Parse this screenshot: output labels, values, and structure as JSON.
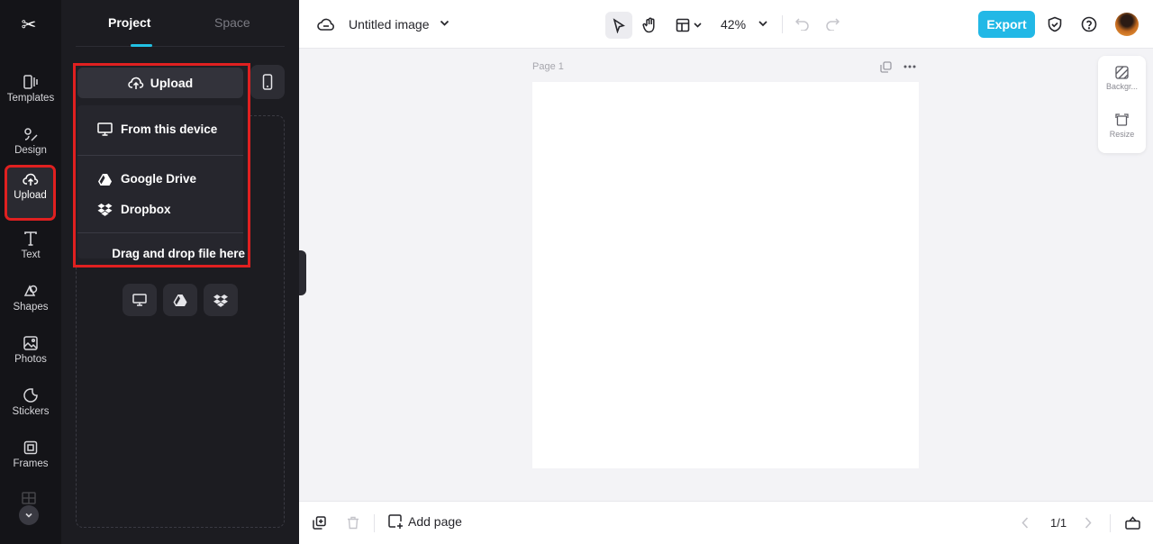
{
  "rail": {
    "logo": "✂",
    "items": [
      {
        "label": "Templates",
        "icon": "templates-icon"
      },
      {
        "label": "Design",
        "icon": "design-icon"
      },
      {
        "label": "Upload",
        "icon": "upload-cloud-icon"
      },
      {
        "label": "Text",
        "icon": "text-icon"
      },
      {
        "label": "Shapes",
        "icon": "shapes-icon"
      },
      {
        "label": "Photos",
        "icon": "photos-icon"
      },
      {
        "label": "Stickers",
        "icon": "stickers-icon"
      },
      {
        "label": "Frames",
        "icon": "frames-icon"
      }
    ]
  },
  "panel": {
    "tabs": {
      "project": "Project",
      "space": "Space"
    },
    "upload_label": "Upload",
    "menu": {
      "from_device": "From this device",
      "google_drive": "Google Drive",
      "dropbox": "Dropbox",
      "drag_hint": "Drag and drop file here"
    }
  },
  "topbar": {
    "doc_title": "Untitled image",
    "zoom": "42%",
    "export_label": "Export"
  },
  "canvas": {
    "page_label": "Page 1",
    "side_tools": {
      "background": "Backgr...",
      "resize": "Resize"
    }
  },
  "bottombar": {
    "add_page": "Add page",
    "pager": "1/1"
  },
  "colors": {
    "accent": "#22b8e6",
    "highlight": "#e02020",
    "rail_bg": "#141418",
    "panel_bg": "#1c1c21"
  }
}
